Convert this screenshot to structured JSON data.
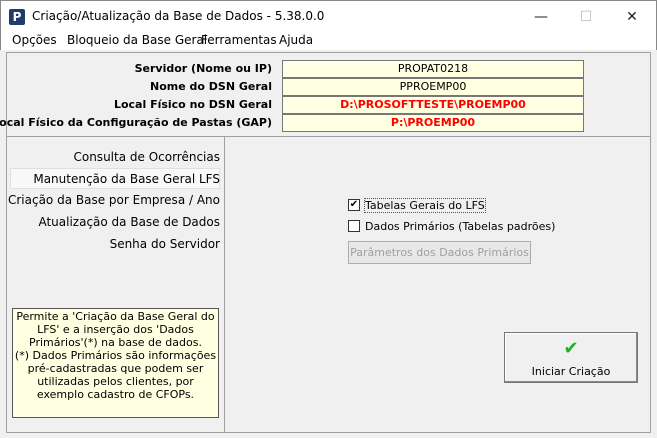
{
  "window": {
    "title": "Criação/Atualização da Base de Dados - 5.38.0.0",
    "icon_letter": "P"
  },
  "menu": [
    "Opções",
    "Bloqueio da Base Geral",
    "Ferramentas",
    "Ajuda"
  ],
  "fields": [
    {
      "label": "Servidor (Nome ou IP)",
      "value": "PROPAT0218"
    },
    {
      "label": "Nome do DSN Geral",
      "value": "PPROEMP00"
    },
    {
      "label": "Local Físico no DSN Geral",
      "value": "D:\\PROSOFTTESTE\\PROEMP00"
    },
    {
      "label": "Local Físico da Configuração de Pastas (GAP)",
      "value": "P:\\PROEMP00"
    }
  ],
  "nav": [
    "Consulta de Ocorrências",
    "Manutenção da Base Geral LFS",
    "Criação da Base por Empresa / Ano",
    "Atualização da Base de Dados",
    "Senha do Servidor"
  ],
  "info": [
    "Permite a 'Criação da Base Geral do LFS' e a inserção dos 'Dados Primários'(*) na base de dados.",
    "(*) Dados Primários são informações pré-cadastradas que podem ser utilizadas pelos clientes, por exemplo cadastro de CFOPs."
  ],
  "options": [
    {
      "label": "Tabelas Gerais do LFS",
      "checked": true
    },
    {
      "label": "Dados Primários (Tabelas padrões)",
      "checked": false
    }
  ],
  "params_button": "Parâmetros dos Dados Primários",
  "start_button": "Iniciar Criação",
  "icons": {
    "check": "✔",
    "minimize": "—",
    "maximize": "☐",
    "close": "✕"
  }
}
